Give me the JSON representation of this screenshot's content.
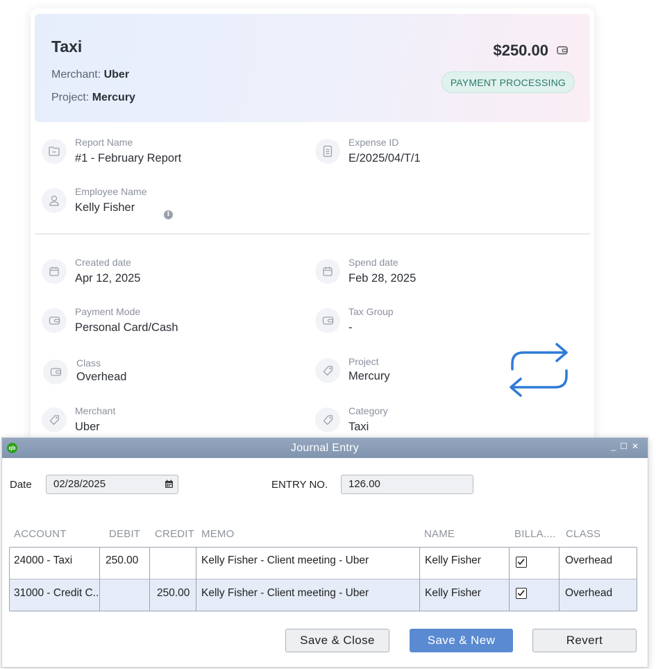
{
  "expense": {
    "title": "Taxi",
    "merchant_label": "Merchant:",
    "merchant_value": "Uber",
    "project_label": "Project:",
    "project_value": "Mercury",
    "amount": "$250.00",
    "status": "PAYMENT PROCESSING",
    "fields": {
      "report_name": {
        "label": "Report Name",
        "value": "#1 - February Report"
      },
      "expense_id": {
        "label": "Expense ID",
        "value": "E/2025/04/T/1"
      },
      "employee_name": {
        "label": "Employee Name",
        "value": "Kelly Fisher"
      },
      "created_date": {
        "label": "Created date",
        "value": "Apr 12, 2025"
      },
      "spend_date": {
        "label": "Spend date",
        "value": "Feb 28, 2025"
      },
      "payment_mode": {
        "label": "Payment Mode",
        "value": "Personal Card/Cash"
      },
      "tax_group": {
        "label": "Tax Group",
        "value": "-"
      },
      "class": {
        "label": "Class",
        "value": "Overhead"
      },
      "project": {
        "label": "Project",
        "value": "Mercury"
      },
      "merchant": {
        "label": "Merchant",
        "value": "Uber"
      },
      "category": {
        "label": "Category",
        "value": "Taxi"
      }
    },
    "accent_color": "#2f7bd6",
    "status_color": "#2c7a6a"
  },
  "journal": {
    "window_title": "Journal Entry",
    "logo_text": "qb",
    "window_controls": {
      "minimize": "_",
      "maximize": "☐",
      "close": "✕"
    },
    "date_label": "Date",
    "date_value": "02/28/2025",
    "entry_no_label": "ENTRY NO.",
    "entry_no_value": "126.00",
    "columns": [
      "ACCOUNT",
      "DEBIT",
      "CREDIT",
      "MEMO",
      "NAME",
      "BILLA....",
      "CLASS"
    ],
    "rows": [
      {
        "account": "24000 - Taxi",
        "debit": "250.00",
        "credit": "",
        "memo": "Kelly Fisher - Client meeting - Uber",
        "name": "Kelly Fisher",
        "billable": true,
        "class": "Overhead"
      },
      {
        "account": "31000 - Credit C..",
        "debit": "",
        "credit": "250.00",
        "memo": "Kelly Fisher - Client meeting - Uber",
        "name": "Kelly Fisher",
        "billable": true,
        "class": "Overhead"
      }
    ],
    "buttons": {
      "save_close": "Save & Close",
      "save_new": "Save & New",
      "revert": "Revert"
    },
    "titlebar_color": "#8a9cb6",
    "primary_button_color": "#5a8ad1"
  }
}
